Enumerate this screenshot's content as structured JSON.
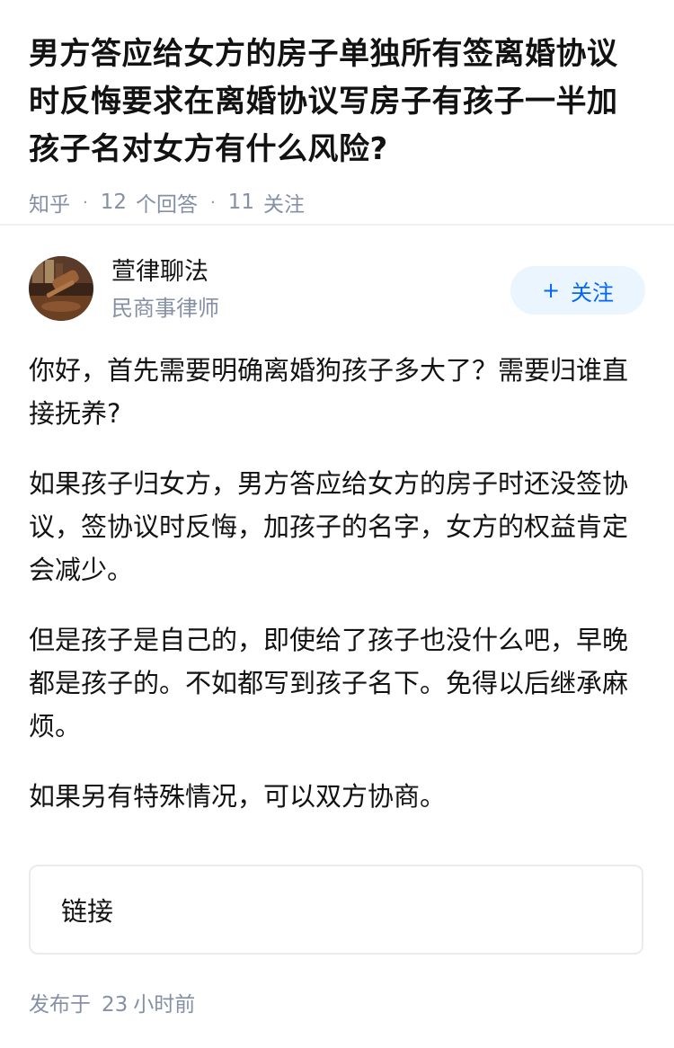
{
  "question": {
    "title": "男方答应给女方的房子单独所有签离婚协议时反悔要求在离婚协议写房子有孩子一半加孩子名对女方有什么风险?",
    "source": "知乎",
    "answer_count": "12",
    "answer_label": "个回答",
    "follow_count": "11",
    "follow_label": "关注"
  },
  "author": {
    "name": "萱律聊法",
    "tag": "民商事律师",
    "avatar_icon": "gavel-avatar",
    "follow_button_label": "关注",
    "follow_button_icon": "plus-icon"
  },
  "answer": {
    "paragraphs": [
      "你好，首先需要明确离婚狗孩子多大了？需要归谁直接抚养?",
      "如果孩子归女方，男方答应给女方的房子时还没签协议，签协议时反悔，加孩子的名字，女方的权益肯定会减少。",
      "但是孩子是自己的，即使给了孩子也没什么吧，早晚都是孩子的。不如都写到孩子名下。免得以后继承麻烦。",
      "如果另有特殊情况，可以双方协商。"
    ]
  },
  "link_card": {
    "label": "链接"
  },
  "publish": {
    "prefix": "发布于",
    "count": "23",
    "suffix": "小时前"
  },
  "colors": {
    "accent": "#0066ff",
    "follow_bg": "#ebf5fd",
    "meta_text": "#8590a6"
  }
}
